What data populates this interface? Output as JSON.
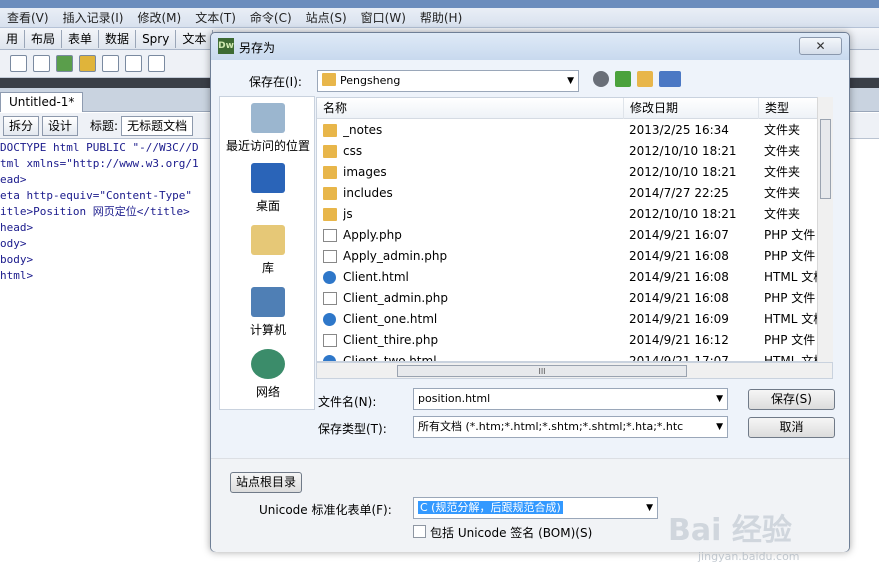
{
  "app": {
    "menus": [
      "查看(V)",
      "插入记录(I)",
      "修改(M)",
      "文本(T)",
      "命令(C)",
      "站点(S)",
      "窗口(W)",
      "帮助(H)"
    ],
    "insert_tabs": [
      "用",
      "布局",
      "表单",
      "数据",
      "Spry",
      "文本"
    ],
    "doc_tab": "Untitled-1*",
    "doc_buttons": {
      "split": "拆分",
      "design": "设计",
      "title_label": "标题:",
      "title_value": "无标题文档"
    },
    "code_lines": [
      "DOCTYPE html PUBLIC \"-//W3C//D",
      "tml xmlns=\"http://www.w3.org/1",
      "ead>",
      "eta http-equiv=\"Content-Type\"",
      "itle>Position 网页定位</title>",
      "head>",
      "",
      "ody>",
      "body>",
      "html>"
    ]
  },
  "dialog": {
    "icon_text": "Dw",
    "title": "另存为",
    "close_label": "✕",
    "save_in_label": "保存在(I):",
    "save_in_value": "Pengsheng",
    "places": [
      "最近访问的位置",
      "桌面",
      "库",
      "计算机",
      "网络"
    ],
    "columns": {
      "name": "名称",
      "date": "修改日期",
      "type": "类型"
    },
    "files": [
      {
        "name": "_notes",
        "date": "2013/2/25 16:34",
        "type": "文件夹",
        "icon": "folder-icon"
      },
      {
        "name": "css",
        "date": "2012/10/10 18:21",
        "type": "文件夹",
        "icon": "folder-icon"
      },
      {
        "name": "images",
        "date": "2012/10/10 18:21",
        "type": "文件夹",
        "icon": "folder-icon"
      },
      {
        "name": "includes",
        "date": "2014/7/27 22:25",
        "type": "文件夹",
        "icon": "folder-icon"
      },
      {
        "name": "js",
        "date": "2012/10/10 18:21",
        "type": "文件夹",
        "icon": "folder-icon"
      },
      {
        "name": "Apply.php",
        "date": "2014/9/21 16:07",
        "type": "PHP 文件",
        "icon": "php-file-icon"
      },
      {
        "name": "Apply_admin.php",
        "date": "2014/9/21 16:08",
        "type": "PHP 文件",
        "icon": "php-file-icon"
      },
      {
        "name": "Client.html",
        "date": "2014/9/21 16:08",
        "type": "HTML 文档",
        "icon": "html-file-icon"
      },
      {
        "name": "Client_admin.php",
        "date": "2014/9/21 16:08",
        "type": "PHP 文件",
        "icon": "php-file-icon"
      },
      {
        "name": "Client_one.html",
        "date": "2014/9/21 16:09",
        "type": "HTML 文档",
        "icon": "html-file-icon"
      },
      {
        "name": "Client_thire.php",
        "date": "2014/9/21 16:12",
        "type": "PHP 文件",
        "icon": "php-file-icon"
      },
      {
        "name": "Client_two.html",
        "date": "2014/9/21 17:07",
        "type": "HTML 文档",
        "icon": "html-file-icon"
      }
    ],
    "filename_label": "文件名(N):",
    "filename_value": "position.html",
    "filetype_label": "保存类型(T):",
    "filetype_value": "所有文档 (*.htm;*.html;*.shtm;*.shtml;*.hta;*.htc",
    "save_button": "保存(S)",
    "cancel_button": "取消",
    "site_root_button": "站点根目录",
    "unicode_label": "Unicode 标准化表单(F):",
    "unicode_value": "C (规范分解，后跟规范合成)",
    "bom_label": "包括 Unicode 签名 (BOM)(S)"
  },
  "watermark": {
    "big": "Bai 经验",
    "small": "jingyan.baidu.com"
  }
}
